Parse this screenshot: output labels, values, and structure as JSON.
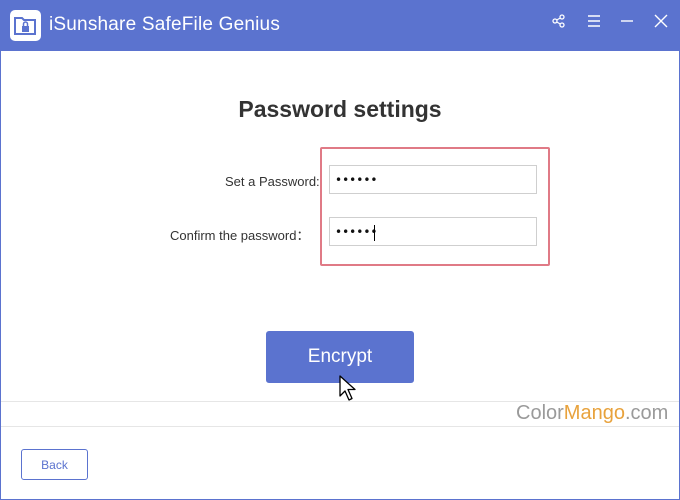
{
  "app": {
    "title": "iSunshare SafeFile Genius",
    "icon": "folder-lock-icon"
  },
  "titlebar_buttons": [
    {
      "name": "share-icon"
    },
    {
      "name": "menu-icon"
    },
    {
      "name": "minimize-icon"
    },
    {
      "name": "close-icon"
    }
  ],
  "page": {
    "heading": "Password settings"
  },
  "form": {
    "password_label": "Set a Password:",
    "password_value": "••••••",
    "confirm_label": "Confirm the password：",
    "confirm_value": "••••••"
  },
  "actions": {
    "encrypt_label": "Encrypt",
    "back_label": "Back"
  },
  "watermark": {
    "part1": "Color",
    "part2": "Mango",
    "part3": ".com"
  },
  "colors": {
    "accent": "#5b73cf",
    "highlight": "#e07a86",
    "watermark_accent": "#e8a23c"
  }
}
